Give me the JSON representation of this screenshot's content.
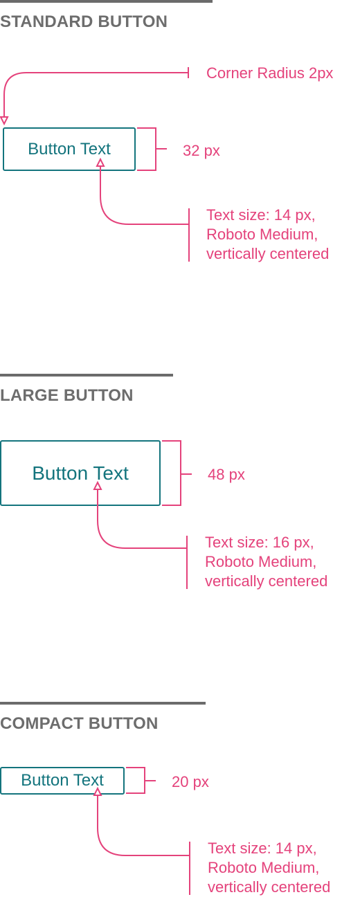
{
  "sections": {
    "standard": {
      "title": "STANDARD BUTTON",
      "button_label": "Button Text",
      "radius_note": "Corner Radius 2px",
      "height_note": "32 px",
      "text_note": [
        "Text size: 14 px,",
        "Roboto Medium,",
        "vertically centered"
      ]
    },
    "large": {
      "title": "LARGE BUTTON",
      "button_label": "Button Text",
      "height_note": "48 px",
      "text_note": [
        "Text size: 16 px,",
        "Roboto Medium,",
        "vertically centered"
      ]
    },
    "compact": {
      "title": "COMPACT BUTTON",
      "button_label": "Button Text",
      "height_note": "20 px",
      "text_note": [
        "Text size: 14 px,",
        "Roboto Medium,",
        "vertically centered"
      ]
    }
  },
  "colors": {
    "title_gray": "#6d6d6d",
    "button_teal": "#13747d",
    "annotation_pink": "#e4427b"
  }
}
